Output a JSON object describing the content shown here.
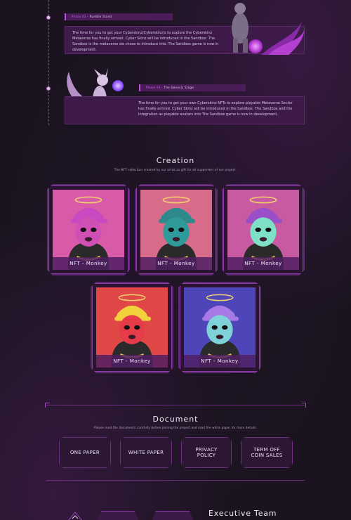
{
  "timeline": {
    "phase1": {
      "label_accent": "Phase 03",
      "label_text": " - Rumble Stand",
      "body": "The time for you to get your Cyberskinz(Cyberskinz)s to explore the Cyberskinz Metaverse has finally arrived. Cyber Skinz will be introduced in the Sandbox. The Sandbox is the metaverse we chose to introduce into. The Sandbox game is now in development."
    },
    "phase2": {
      "label_accent": "Phase 04",
      "label_text": " - The Genesis Stage",
      "body": "The time for you to get your own Cyberskinz NFTs to explore playable Metaverse Sector has finally arrived. Cyber Skinz will be introduced in the Sandbox. The Sandbox and the Integration as playable avatars into The Sandbox game is now in development."
    }
  },
  "creation": {
    "title": "Creation",
    "subtitle": "The NFT collection created by our artist as gift for all supporters of our project.",
    "cards": [
      {
        "caption": "NFT - Monkey",
        "bg": "#d85aa8",
        "mask": "#cf4fb5",
        "cap": "#c94ac0"
      },
      {
        "caption": "NFT - Monkey",
        "bg": "#d86a8a",
        "mask": "#2f9a9a",
        "cap": "#2e8a8a"
      },
      {
        "caption": "NFT - Monkey",
        "bg": "#c75aa0",
        "mask": "#7fe0c8",
        "cap": "#9a4fc8"
      },
      {
        "caption": "NFT - Monkey",
        "bg": "#e04848",
        "mask": "#e63c4a",
        "cap": "#f2d23c"
      },
      {
        "caption": "NFT - Monkey",
        "bg": "#4e45b8",
        "mask": "#7fd3d8",
        "cap": "#a87ae6"
      }
    ]
  },
  "document": {
    "title": "Document",
    "subtitle": "Please read the documents carefully before joining the project and read the white paper for more details.",
    "buttons": [
      {
        "label": "ONE PAPER"
      },
      {
        "label": "WHITE PAPER"
      },
      {
        "label": "PRIVACY POLICY"
      },
      {
        "label": "TERM OFF COIN SALES"
      }
    ]
  },
  "executive": {
    "title": "Executive Team"
  },
  "colors": {
    "accent": "#c04fe0",
    "background": "#1b1420",
    "panel": "#3d1a4a"
  }
}
